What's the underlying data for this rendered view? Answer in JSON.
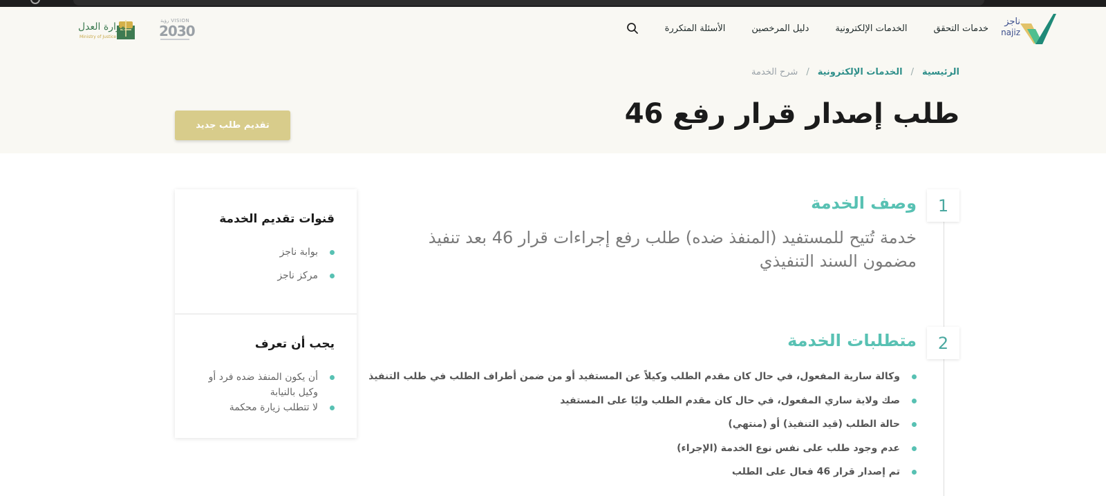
{
  "header": {
    "logo_text_ar": "ناجز",
    "logo_text_en": "najiz",
    "nav": [
      {
        "label": "خدمات التحقق"
      },
      {
        "label": "الخدمات الإلكترونية"
      },
      {
        "label": "دليل المرخصين"
      },
      {
        "label": "الأسئلة المتكررة"
      }
    ],
    "vision_label": "2030",
    "vision_top": "VISION رؤية",
    "moj_ar": "وزارة العدل",
    "moj_en": "Ministry of Justice"
  },
  "breadcrumb": {
    "home": "الرئيسية",
    "sep": "/",
    "services": "الخدمات الإلكترونية",
    "current": "شرح الخدمة"
  },
  "page": {
    "title": "طلب إصدار قرار رفع 46",
    "new_request_label": "تقديم طلب جديد"
  },
  "sections": [
    {
      "number": "1",
      "title": "وصف الخدمة",
      "description": "خدمة تُتيح للمستفيد (المنفذ ضده) طلب رفع إجراءات قرار 46 بعد تنفيذ مضمون السند التنفيذي"
    },
    {
      "number": "2",
      "title": "متطلبات الخدمة",
      "requirements": [
        "وكالة سارية المفعول، في حال كان مقدم الطلب وكيلاً عن المستفيد أو من ضمن أطراف الطلب في طلب التنفيذ",
        "صك ولاية ساري المفعول، في حال كان مقدم الطلب وليًا على المستفيد",
        "حالة الطلب (قيد التنفيذ) أو (منتهي)",
        "عدم وجود طلب على نفس نوع الخدمة (الإجراء)",
        "تم إصدار قرار 46 فعال على الطلب"
      ]
    }
  ],
  "sidebar": {
    "channels_title": "قنوات تقديم الخدمة",
    "channels": [
      "بوابة ناجز",
      "مركز ناجز"
    ],
    "notes_title": "يجب أن تعرف",
    "notes": [
      "أن يكون المنفذ ضده فرد أو وكيل بالنيابة",
      "لا تتطلب زيارة محكمة"
    ]
  },
  "colors": {
    "accent": "#58c1b3",
    "button": "#d8cc8b",
    "header_bg": "#f9f8f3"
  }
}
